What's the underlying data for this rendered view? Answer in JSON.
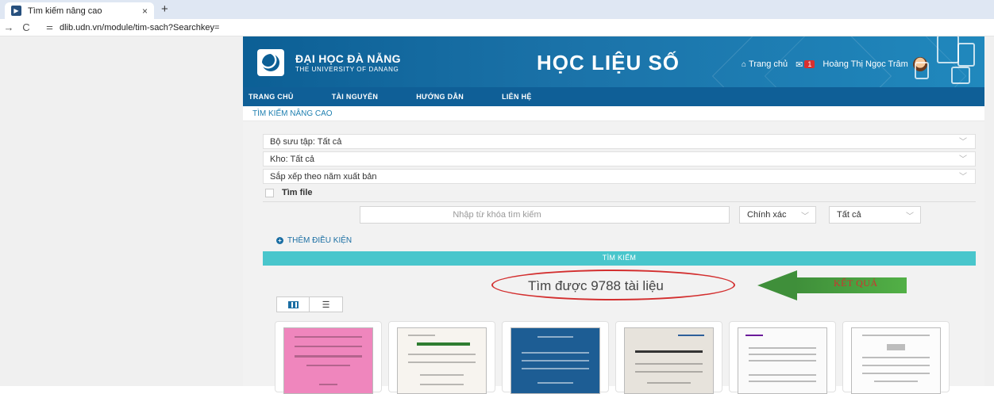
{
  "browser": {
    "tab_title": "Tìm kiếm nâng cao",
    "tab_close": "×",
    "new_tab": "+",
    "url": "dlib.udn.vn/module/tim-sach?Searchkey=",
    "back_glyph": "→",
    "reload_glyph": "C"
  },
  "header": {
    "university_name": "ĐẠI HỌC ĐÀ NẴNG",
    "university_subtitle": "THE UNIVERSITY OF DANANG",
    "site_title": "HỌC LIỆU SỐ",
    "home_link": "Trang chủ",
    "notification_count": "1",
    "user_name": "Hoàng Thị Ngọc Trâm"
  },
  "nav": {
    "items": [
      {
        "label": "TRANG CHỦ"
      },
      {
        "label": "TÀI NGUYÊN"
      },
      {
        "label": "HƯỚNG DẪN"
      },
      {
        "label": "LIÊN HỆ"
      }
    ]
  },
  "breadcrumb": "TÌM KIẾM NÂNG CAO",
  "form": {
    "collection_select": "Bộ sưu tập: Tất cả",
    "repository_select": "Kho: Tất cả",
    "sort_select": "Sắp xếp theo năm xuất bản",
    "file_search_label": "Tìm file",
    "keyword_placeholder": "Nhập từ khóa tìm kiếm",
    "match_select": "Chính xác",
    "field_select": "Tất cả",
    "add_condition": "THÊM ĐIỀU KIỆN",
    "search_button": "TÌM KIẾM"
  },
  "results": {
    "count_text": "Tìm được 9788 tài liệu",
    "annotation_label": "KẾT QUẢ"
  },
  "view_toggle": {
    "grid_icon": "grid-icon",
    "list_icon": "list-icon",
    "selected": "grid"
  },
  "colors": {
    "banner": "#0c5f95",
    "nav": "#0f5f97",
    "search_button": "#49c6cc",
    "annotation": "#d32f2f",
    "arrow": "#3f8f3a"
  }
}
